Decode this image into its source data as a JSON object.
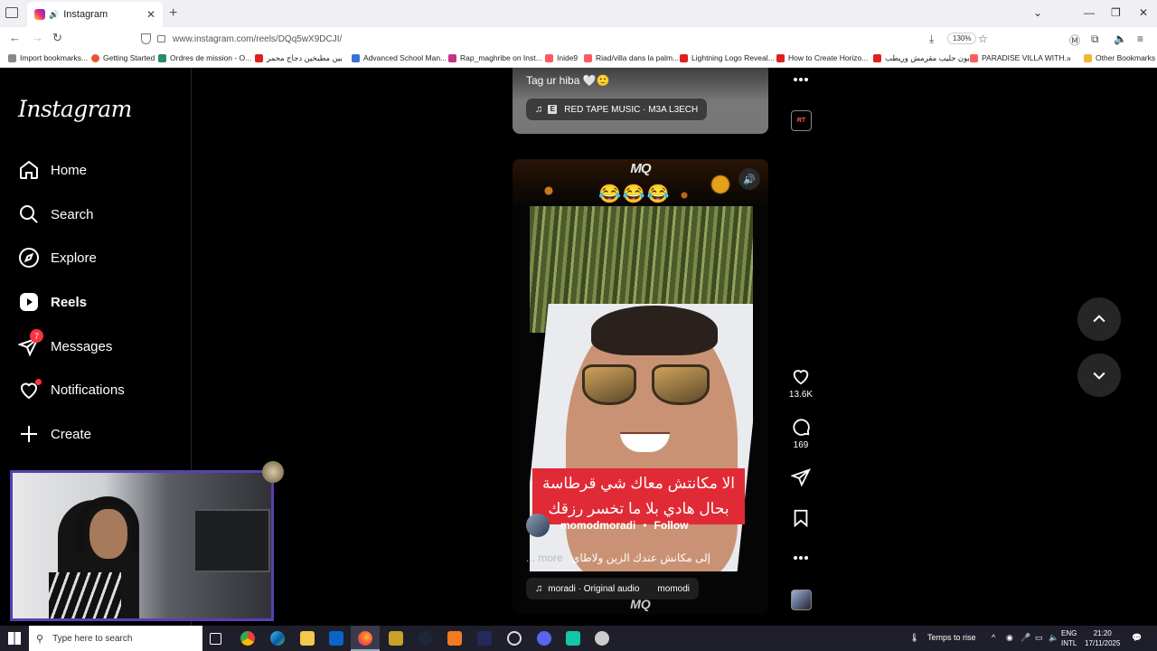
{
  "browser": {
    "tab_title": "Instagram",
    "url": "www.instagram.com/reels/DQq5wX9DCJI/",
    "zoom": "130%",
    "bookmarks": [
      "Import bookmarks...",
      "Getting Started",
      "Ordres de mission - O...",
      "بين مطبخين دجاج محمر",
      "Advanced School Man...",
      "Rap_maghribe on Inst...",
      "Inide9",
      "Riad/villa dans la palm...",
      "Lightning Logo Reveal...",
      "How to Create Horizo...",
      "بون جليب مقرمش وريطب",
      "PARADISE VILLA WITH...",
      "Other Bookmarks"
    ]
  },
  "sidebar": {
    "logo": "Instagram",
    "items": [
      {
        "label": "Home",
        "icon": "home-icon"
      },
      {
        "label": "Search",
        "icon": "search-icon"
      },
      {
        "label": "Explore",
        "icon": "compass-icon"
      },
      {
        "label": "Reels",
        "icon": "reels-icon"
      },
      {
        "label": "Messages",
        "icon": "messages-icon",
        "badge": "7"
      },
      {
        "label": "Notifications",
        "icon": "heart-icon"
      },
      {
        "label": "Create",
        "icon": "plus-icon"
      }
    ]
  },
  "reel_prev": {
    "caption": "Tag ur hiba 🤍🙂",
    "audio": "RED TAPE MUSIC · M3A L3ECH"
  },
  "reel": {
    "watermark": "MQ",
    "emojis": "😂😂😂",
    "overlay_text_line1": "الا مكانتش معاك شي قرطاسة",
    "overlay_text_line2": "بحال هادي بلا ما تخسر رزقك",
    "author": "momodmoradi",
    "follow_label": "Follow",
    "description": "إلى مكانش عندك الزين ولاطاي",
    "more_label": "... more",
    "audio": "moradi · Original audio",
    "audio_extra": "momodi",
    "likes": "13.6K",
    "comments": "169",
    "prev_badge": "RT"
  },
  "taskbar": {
    "search_placeholder": "Type here to search",
    "weather": "Temps to rise",
    "lang_top": "ENG",
    "lang_bottom": "INTL",
    "time": "21:20",
    "date": "17/11/2025"
  },
  "colors": {
    "accent_red": "#ff3040",
    "overlay_red": "#e02a35",
    "webcam_border": "#5a3fb0"
  }
}
